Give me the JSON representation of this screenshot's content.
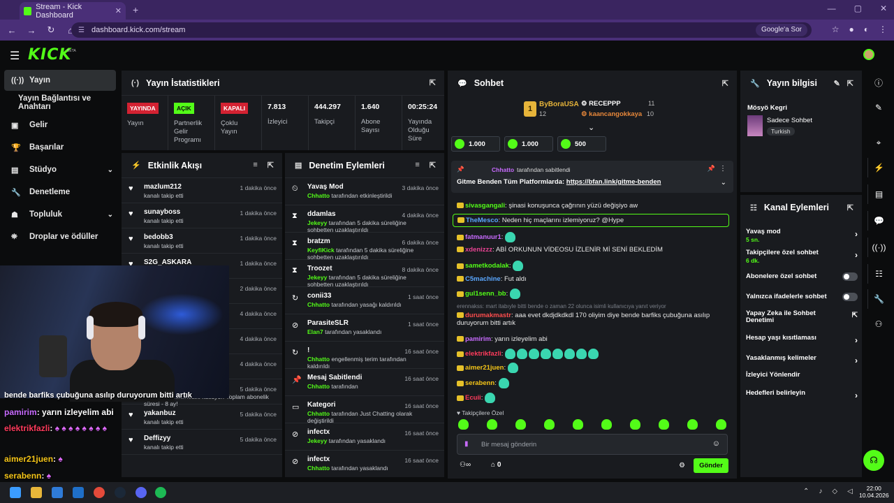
{
  "browser": {
    "tab_title": "Stream - Kick Dashboard",
    "url": "dashboard.kick.com/stream",
    "google_pill": "Google'a Sor"
  },
  "header": {
    "logo": "KICK",
    "beta": "BETA"
  },
  "sidebar": {
    "items": [
      {
        "label": "Yayın",
        "icon": "broadcast-icon"
      },
      {
        "label": "Yayın Bağlantısı ve Anahtarı"
      },
      {
        "label": "Gelir",
        "icon": "wallet-icon"
      },
      {
        "label": "Başarılar",
        "icon": "trophy-icon"
      },
      {
        "label": "Stüdyo",
        "icon": "studio-icon"
      },
      {
        "label": "Denetleme",
        "icon": "wrench-icon"
      },
      {
        "label": "Topluluk",
        "icon": "community-icon"
      },
      {
        "label": "Droplar ve ödüller",
        "icon": "gift-icon"
      }
    ]
  },
  "stats": {
    "title": "Yayın İstatistikleri",
    "cells": [
      {
        "badge": "YAYINDA",
        "label": "Yayın"
      },
      {
        "badge": "AÇIK",
        "label": "Partnerlik Gelir Programı"
      },
      {
        "badge": "KAPALI",
        "label": "Çoklu Yayın"
      },
      {
        "value": "7.813",
        "label": "İzleyici"
      },
      {
        "value": "444.297",
        "label": "Takipçi"
      },
      {
        "value": "1.640",
        "label": "Abone Sayısı"
      },
      {
        "value": "00:25:24",
        "label": "Yayında Olduğu Süre"
      }
    ]
  },
  "activity": {
    "title": "Etkinlik Akışı",
    "rows": [
      {
        "name": "mazlum212",
        "desc": "kanalı takip etti",
        "time": "1 dakika önce"
      },
      {
        "name": "sunayboss",
        "desc": "kanalı takip etti",
        "time": "1 dakika önce"
      },
      {
        "name": "bedobb3",
        "desc": "kanalı takip etti",
        "time": "1 dakika önce"
      },
      {
        "name": "S2G_ASKARA",
        "desc": "",
        "time": "1 dakika önce"
      },
      {
        "name": "",
        "desc": "",
        "time": "2 dakika önce"
      },
      {
        "name": "",
        "desc": "",
        "time": "4 dakika önce"
      },
      {
        "name": "",
        "desc": "",
        "time": "4 dakika önce"
      },
      {
        "name": "",
        "desc": "",
        "time": "4 dakika önce"
      },
      {
        "name": "",
        "desc": "abonelik yenilemesini kutluyor! Toplam abonelik süresi - 8 ay!",
        "time": "5 dakika önce"
      },
      {
        "name": "yakanbuz",
        "desc": "kanalı takip etti",
        "time": "5 dakika önce"
      },
      {
        "name": "Deffizyy",
        "desc": "kanalı takip etti",
        "time": "5 dakika önce"
      }
    ]
  },
  "moderation": {
    "title": "Denetim Eylemleri",
    "rows": [
      {
        "name": "Yavaş Mod",
        "actor": "Chhatto",
        "desc": "tarafından etkinleştirildi",
        "time": "3 dakika önce"
      },
      {
        "name": "ddamlas",
        "actor": "Jekeyy",
        "desc": "tarafından 5 dakika süreliğine sohbetten uzaklaştırıldı",
        "time": "4 dakika önce"
      },
      {
        "name": "bratzm",
        "actor": "KeyfiKick",
        "desc": "tarafından 5 dakika süreliğine sohbetten uzaklaştırıldı",
        "time": "6 dakika önce"
      },
      {
        "name": "Troozet",
        "actor": "Jekeyy",
        "desc": "tarafından 5 dakika süreliğine sohbetten uzaklaştırıldı",
        "time": "8 dakika önce"
      },
      {
        "name": "conii33",
        "actor": "Chhatto",
        "desc": "tarafından yasağı kaldırıldı",
        "time": "1 saat önce"
      },
      {
        "name": "ParasiteSLR",
        "actor": "Elan7",
        "desc": "tarafından yasaklandı",
        "time": "1 saat önce"
      },
      {
        "name": "!",
        "actor": "Chhatto",
        "desc": "engellenmiş terim tarafından kaldırıldı",
        "time": "16 saat önce"
      },
      {
        "name": "Mesaj Sabitlendi",
        "actor": "Chhatto",
        "desc": "tarafından",
        "time": "16 saat önce"
      },
      {
        "name": "Kategori",
        "actor": "Chhatto",
        "desc": "tarafından Just Chatting olarak değiştirildi",
        "time": "16 saat önce"
      },
      {
        "name": "infectx",
        "actor": "Jekeyy",
        "desc": "tarafından yasaklandı",
        "time": "16 saat önce"
      },
      {
        "name": "infectx",
        "actor": "Chhatto",
        "desc": "tarafından yasaklandı",
        "time": "16 saat önce"
      }
    ]
  },
  "chat": {
    "title": "Sohbet",
    "leaders": [
      {
        "name": "ByBoraUSA",
        "count": "12"
      },
      {
        "name": "RECEPPP",
        "count": "11"
      },
      {
        "name": "kaancangokkaya",
        "count": "10"
      }
    ],
    "rank": "1",
    "goals": [
      "1.000",
      "1.000",
      "500"
    ],
    "pinned_by": "Chhatto",
    "pinned_suffix": "tarafından sabitlendi",
    "pinned_text": "Gitme Benden Tüm Platformlarda: ",
    "pinned_link": "https://bfan.link/gitme-benden",
    "messages": [
      {
        "user": "sivasgangali",
        "text": "şinasi konuşunca çağrının yüzü değişiyo aw",
        "color": "#53fc18"
      },
      {
        "user": "TheMesco",
        "text": "Neden hiç maçlarını izlemiyoruz? @Hype",
        "color": "#5aa7ff"
      },
      {
        "user": "fatmanuur1",
        "text": "",
        "color": "#c86bff"
      },
      {
        "user": "xdenizzz",
        "text": "ABİ ORKUNUN VİDEOSU İZLENİR Mİ SENİ BEKLEDİM",
        "color": "#e84393"
      },
      {
        "user": "sametkodalak",
        "text": "",
        "color": "#53fc18"
      },
      {
        "user": "C5machine",
        "text": "Fut aldı",
        "color": "#5aa7ff"
      },
      {
        "user": "gul1senn_bb",
        "text": "",
        "color": "#53fc18"
      },
      {
        "user": "",
        "text": "erennakss: mart itabıyle bitti bende o zaman 22 olunca isimli kullanıcıya yanıt veriyor",
        "color": "#7a7f88"
      },
      {
        "user": "durumakmastr",
        "text": "aaa evet dkdjdkdkdl 170 oliyim diye bende barfiks çubuğuna asılıp duruyorum bitti artık",
        "color": "#ff4d4d"
      },
      {
        "user": "pamirim",
        "text": "yarın izleyelim abi",
        "color": "#c86bff"
      },
      {
        "user": "elektrikfazli",
        "text": "",
        "color": "#ff3b5c"
      },
      {
        "user": "aimer21juen",
        "text": "",
        "color": "#f5c518"
      },
      {
        "user": "serabenn",
        "text": "",
        "color": "#f5c518"
      },
      {
        "user": "Ecuii",
        "text": "",
        "color": "#ff3b5c"
      }
    ],
    "emote_label": "Takipçilere Özel",
    "input_placeholder": "Bir mesaj gönderin",
    "points": "0",
    "send_label": "Gönder"
  },
  "info": {
    "title": "Yayın bilgisi",
    "stream_title": "Mösyö Kegri",
    "category": "Sadece Sohbet",
    "language": "Turkish"
  },
  "channel_actions": {
    "title": "Kanal Eylemleri",
    "items": [
      {
        "label": "Yavaş mod",
        "sub": "5 sn."
      },
      {
        "label": "Takipçilere özel sohbet",
        "sub": "6 dk."
      },
      {
        "label": "Abonelere özel sohbet",
        "sub": ""
      },
      {
        "label": "Yalnızca ifadelerle sohbet",
        "sub": ""
      },
      {
        "label": "Yapay Zeka ile Sohbet Denetimi",
        "sub": ""
      },
      {
        "label": "Hesap yaşı kısıtlaması",
        "sub": ""
      },
      {
        "label": "Yasaklanmış kelimeler",
        "sub": ""
      },
      {
        "label": "İzleyici Yönlendir",
        "sub": ""
      },
      {
        "label": "Hedefleri belirleyin",
        "sub": ""
      }
    ]
  },
  "overlay": {
    "line0": "bende barfiks çubuğuna asılıp duruyorum bitti artık",
    "lines": [
      {
        "user": "pamirim",
        "text": ": yarın izleyelim abi"
      },
      {
        "user": "elektrikfazli",
        "text": ":"
      },
      {
        "user": "aimer21juen",
        "text": ":"
      },
      {
        "user": "serabenn",
        "text": ":"
      }
    ]
  },
  "taskbar": {
    "time": "22:00",
    "date": "10.04.2026"
  },
  "colors": {
    "accent": "#53fc18",
    "panel": "#191b1f",
    "bg": "#0b0c0d",
    "tabbar": "#3a2560"
  }
}
